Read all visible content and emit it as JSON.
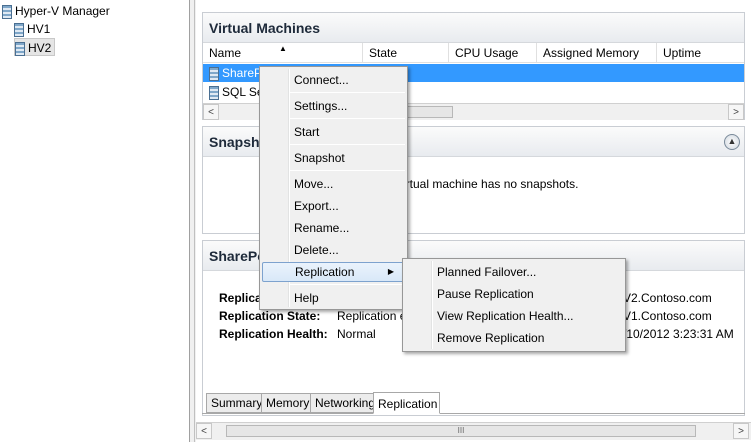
{
  "tree": {
    "root": "Hyper-V Manager",
    "servers": [
      "HV1",
      "HV2"
    ]
  },
  "vm_pane": {
    "title": "Virtual Machines",
    "columns": [
      "Name",
      "State",
      "CPU Usage",
      "Assigned Memory",
      "Uptime"
    ],
    "rows": [
      {
        "name": "SharePoint"
      },
      {
        "name": "SQL Se"
      }
    ]
  },
  "snapshot_pane": {
    "title": "Snapsh",
    "message": "cted virtual machine has no snapshots."
  },
  "details_pane": {
    "title": "SharePo",
    "props": [
      {
        "label": "Replica",
        "value": "",
        "right": "V2.Contoso.com"
      },
      {
        "label": "Replication State:",
        "value": "Replication en",
        "right": "V1.Contoso.com"
      },
      {
        "label": "Replication Health:",
        "value": "Normal",
        "right": "/10/2012 3:23:31 AM"
      }
    ],
    "tabs": [
      "Summary",
      "Memory",
      "Networking",
      "Replication"
    ],
    "active_tab": "Replication"
  },
  "context_menu": {
    "items": [
      "Connect...",
      "Settings...",
      "Start",
      "Snapshot",
      "Move...",
      "Export...",
      "Rename...",
      "Delete...",
      "Replication",
      "Help"
    ],
    "highlighted": "Replication"
  },
  "submenu": {
    "items": [
      "Planned Failover...",
      "Pause Replication",
      "View Replication Health...",
      "Remove Replication"
    ]
  },
  "scroll": {
    "left": "<",
    "right": ">",
    "grip": "III"
  },
  "colors": {
    "selection": "#3399ff",
    "menu_highlight": "#d9e8f8",
    "pane_header": "#e8ebef"
  }
}
